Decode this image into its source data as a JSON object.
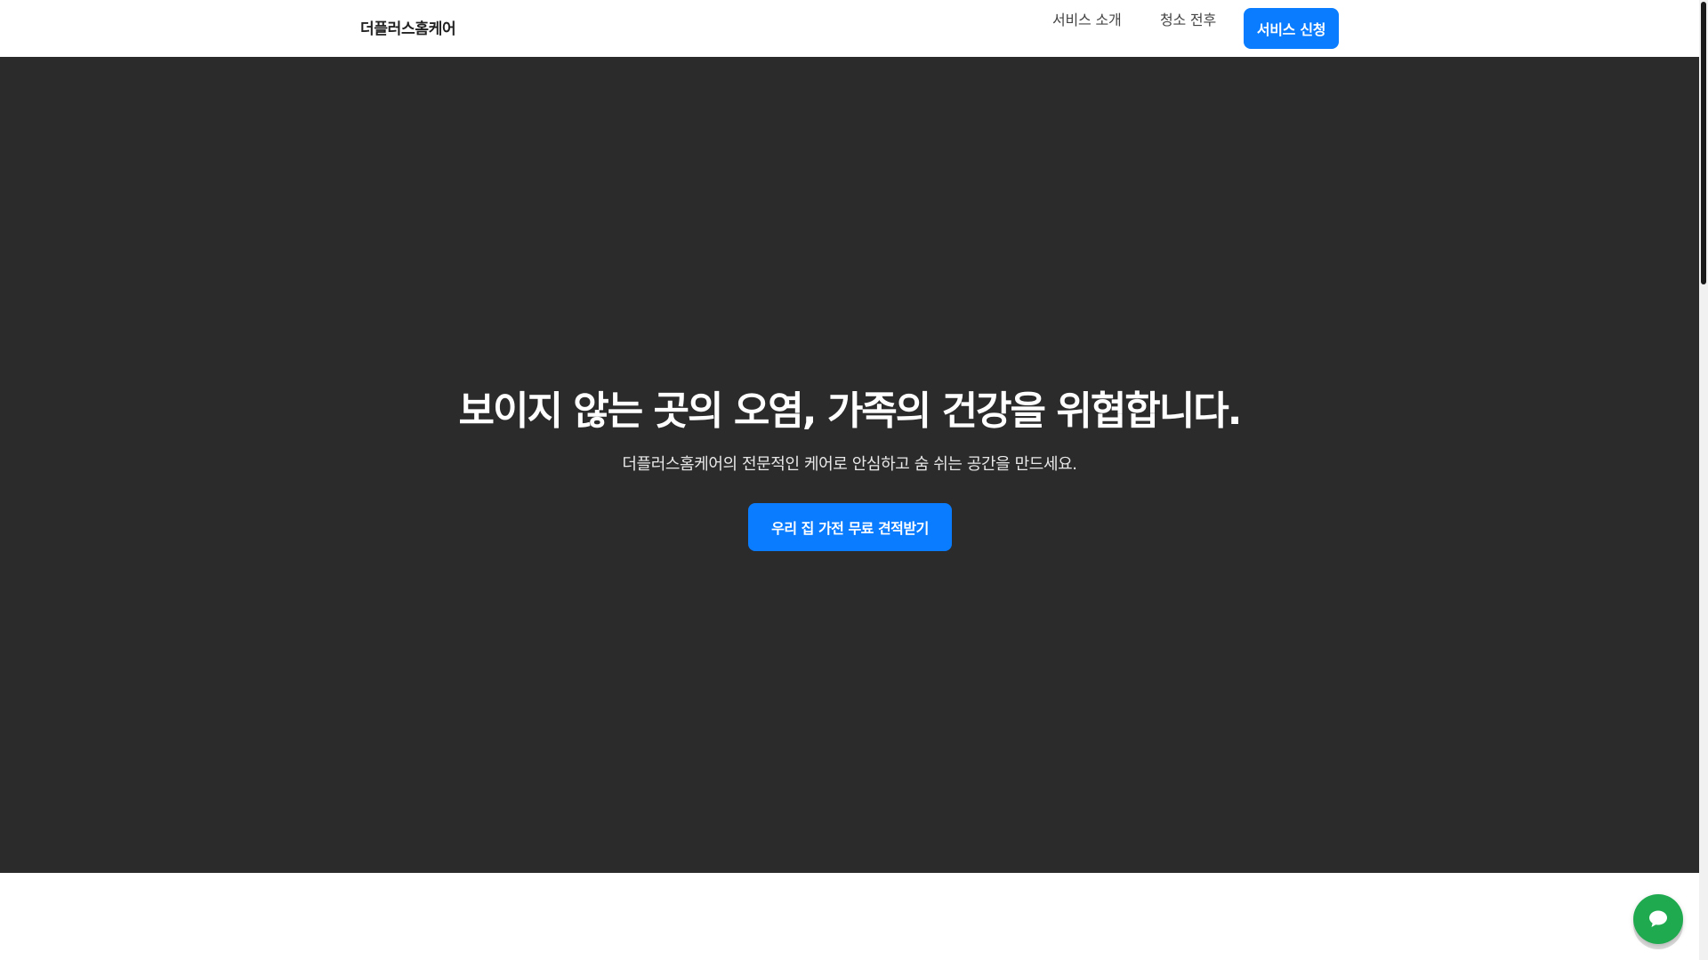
{
  "header": {
    "logo": "더플러스홈케어",
    "nav": [
      {
        "label": "서비스 소개"
      },
      {
        "label": "청소 전후"
      }
    ],
    "apply_label": "서비스 신청"
  },
  "hero": {
    "title": "보이지 않는 곳의 오염, 가족의 건강을 위협합니다.",
    "subtitle": "더플러스홈케어의 전문적인 케어로 안심하고 숨 쉬는 공간을 만드세요.",
    "cta_label": "우리 집 가전 무료 견적받기"
  },
  "chat": {
    "icon": "chat-bubble-icon"
  },
  "colors": {
    "accent": "#0a7cff",
    "hero_bg": "#2b2b2b",
    "chat": "#1faa4f"
  }
}
